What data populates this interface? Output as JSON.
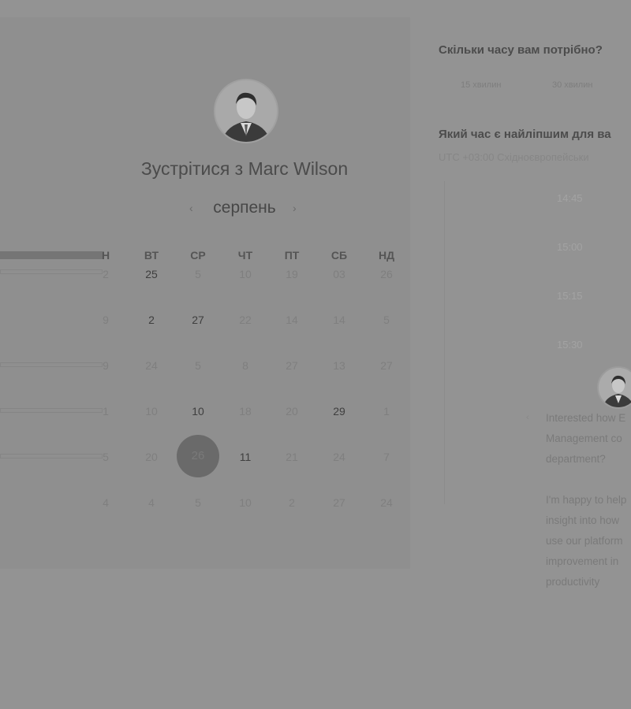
{
  "scheduler": {
    "title": "Зустрітися з Marc Wilson",
    "month": "серпень",
    "prev_icon": "chevron-left-icon",
    "next_icon": "chevron-right-icon",
    "weekdays": [
      "Н",
      "ВТ",
      "СР",
      "ЧТ",
      "ПТ",
      "СБ",
      "НД"
    ],
    "weeks": [
      [
        "2",
        "25",
        "5",
        "10",
        "19",
        "03",
        "26"
      ],
      [
        "9",
        "2",
        "27",
        "22",
        "14",
        "14",
        "5"
      ],
      [
        "9",
        "24",
        "5",
        "8",
        "27",
        "13",
        "27"
      ],
      [
        "1",
        "10",
        "10",
        "18",
        "20",
        "29",
        "1"
      ],
      [
        "5",
        "20",
        "26",
        "11",
        "21",
        "24",
        "7"
      ],
      [
        "4",
        "4",
        "5",
        "10",
        "2",
        "27",
        "24"
      ]
    ],
    "selected_day": "26"
  },
  "right_panel": {
    "question_duration": "Скільки часу вам потрібно?",
    "durations": [
      "15 хвилин",
      "30 хвилин"
    ],
    "question_time": "Який час є найліпшим для ва",
    "timezone": "UTC +03:00 Східноєвропейськи",
    "time_slots": [
      "14:45",
      "15:00",
      "15:15",
      "15:30"
    ],
    "chat_paragraph_1": [
      "Interested how E",
      "Management co",
      "department?"
    ],
    "chat_paragraph_2": [
      "I'm happy to help",
      "insight into how",
      "use our platform",
      "improvement in",
      "productivity"
    ]
  },
  "colors": {
    "overlay": "#939393",
    "selected_day_bg": "#6a6a6a"
  }
}
